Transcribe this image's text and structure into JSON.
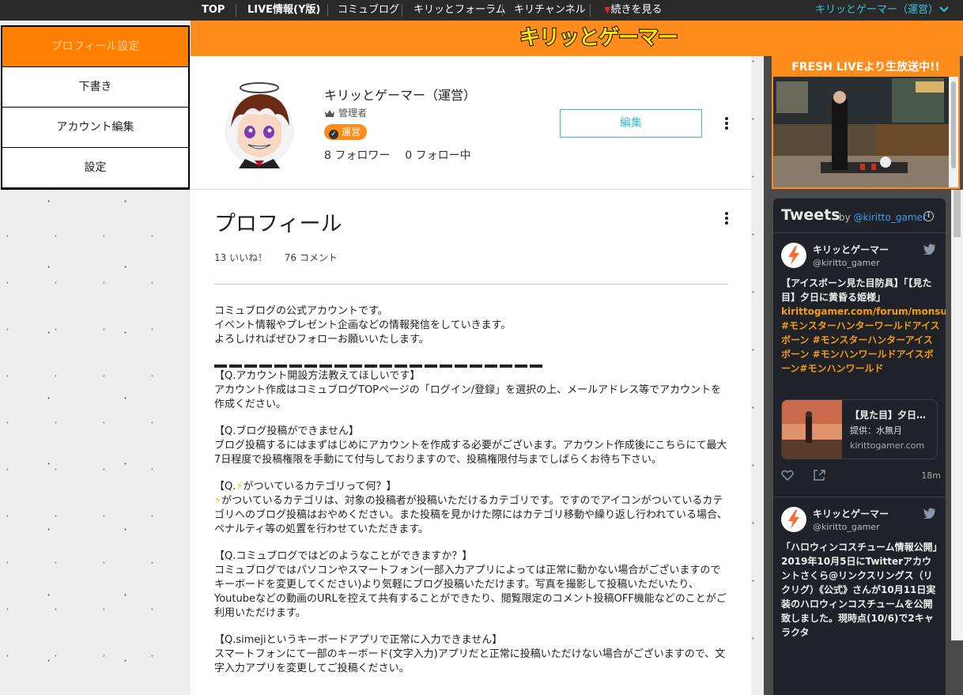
{
  "topnav": {
    "items": [
      "TOP",
      "LIVE情報(Y版)",
      "コミュブログ",
      "キリッとフォーラム",
      "キリチャンネル"
    ],
    "more": "続きを見る",
    "user": "キリッとゲーマー（運営）"
  },
  "header": {
    "logo": "キリッとゲーマー"
  },
  "menu": {
    "items": [
      "プロフィール設定",
      "下書き",
      "アカウント編集",
      "設定"
    ]
  },
  "profile": {
    "name": "キリッとゲーマー（運営）",
    "role": "管理者",
    "badge": "運営",
    "followers": "8 フォロワー",
    "following": "0 フォロー中",
    "edit_label": "編集"
  },
  "article": {
    "title": "プロフィール",
    "likes": "13 いいね！",
    "comments": "76 コメント",
    "paragraphs": [
      [
        "コミュブログの公式アカウントです。",
        "イベント情報やプレゼント企画などの情報発信をしていきます。",
        "よろしければぜひフォローお願いいたします。"
      ],
      [
        "【Q.アカウント開設方法教えてほしいです】",
        "アカウント作成はコミュブログTOPページの「ログイン/登録」を選択の上、メールアドレス等でアカウントを作成ください。"
      ],
      [
        "【Q.ブログ投稿ができません】",
        "ブログ投稿するにはまずはじめにアカウントを作成する必要がございます。アカウント作成後にこちらにて最大7日程度で投稿権限を手動にて付与しておりますので、投稿権限付与までしばらくお待ち下さい。"
      ],
      [
        "【Q.",
        "がついているカテゴリって何？】",
        "がついているカテゴリは、対象の投稿者が投稿いただけるカテゴリです。ですのでアイコンがついているカテゴリへのブログ投稿はおやめください。また投稿を見かけた際にはカテゴリ移動や繰り返し行われている場合、ペナルティ等の処置を行わせていただきます。"
      ],
      [
        "【Q.コミュブログではどのようなことができますか？】",
        "コミュブログではパソコンやスマートフォン(一部入力アプリによっては正常に動かない場合がございますのでキーボードを変更してください)より気軽にブログ投稿いただけます。写真を撮影して投稿いただいたり、Youtubeなどの動画のURLを控えて共有することができたり、閲覧限定のコメント投稿OFF機能などのことがご利用いただけます。"
      ],
      [
        "【Q.simejiというキーボードアプリで正常に入力できません】",
        "スマートフォンにて一部のキーボード(文字入力)アプリだと正常に投稿いただけない場合がございますので、文字入力アプリを変更してご投稿ください。"
      ]
    ]
  },
  "live": {
    "title": "FRESH LIVEより生放送中!!"
  },
  "tweets": {
    "heading": "Tweets",
    "by": "by",
    "handle_link": "@kiritto_gamer",
    "items": [
      {
        "name": "キリッとゲーマー",
        "handle": "@kiritto_gamer",
        "text_plain": "【アイスボーン見た目防具】「【見た目】夕日に黄昏る姫様」",
        "text_link": "kirittogamer.com/forum/monsutah…",
        "text_tags": "#モンスターハンターワールドアイスボーン #モンスターハンターアイスボーン #モンハンワールドアイスボーン#モンハンワールド",
        "card_title": "【見た目】夕日…",
        "card_sub": "提供：水無月",
        "card_domain": "kirittogamer.com",
        "time": "18m"
      },
      {
        "name": "キリッとゲーマー",
        "handle": "@kiritto_gamer",
        "text_plain": "「ハロウィンコスチューム情報公開」2019年10月5日にTwitterアカウントさくら@リンクスリングス（リクリグ）《公式》さんが10月11日実装のハロウィンコスチュームを公開致しました。現時点(10/6)で2キャラクタ"
      }
    ]
  },
  "colors": {
    "accent": "#ff8c1a",
    "link": "#39b9c9",
    "logo": "#ffe600"
  }
}
